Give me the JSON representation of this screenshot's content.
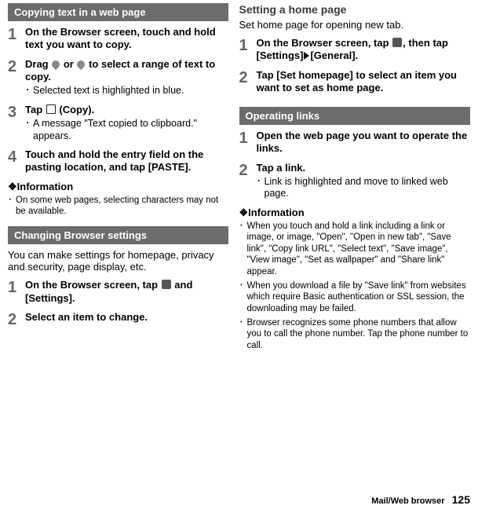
{
  "left": {
    "s1": {
      "header": "Copying text in a web page",
      "steps": [
        {
          "num": "1",
          "title": "On the Browser screen, touch and hold text you want to copy."
        },
        {
          "num": "2",
          "title_pre": "Drag ",
          "title_mid": " or ",
          "title_post": " to select a range of text to copy.",
          "bullets": [
            "Selected text is highlighted in blue."
          ]
        },
        {
          "num": "3",
          "title_pre": "Tap ",
          "title_post": " (Copy).",
          "bullets": [
            "A message \"Text copied to clipboard.\" appears."
          ]
        },
        {
          "num": "4",
          "title": "Touch and hold the entry field on the pasting location, and tap [PASTE]."
        }
      ],
      "info_head": "❖Information",
      "info": [
        "On some web pages, selecting characters may not be available."
      ]
    },
    "s2": {
      "header": "Changing Browser settings",
      "intro": "You can make settings for homepage, privacy and security, page display, etc.",
      "steps": [
        {
          "num": "1",
          "title_pre": "On the Browser screen, tap ",
          "title_post": " and [Settings]."
        },
        {
          "num": "2",
          "title": "Select an item to change."
        }
      ]
    }
  },
  "right": {
    "s3": {
      "header": "Setting a home page",
      "intro": "Set home page for opening new tab.",
      "steps": [
        {
          "num": "1",
          "title_pre": "On the Browser screen, tap ",
          "title_mid": ", then tap [Settings]",
          "title_post": "[General]."
        },
        {
          "num": "2",
          "title": "Tap [Set homepage] to select an item you want to set as home page."
        }
      ]
    },
    "s4": {
      "header": "Operating links",
      "steps": [
        {
          "num": "1",
          "title": "Open the web page you want to operate the links."
        },
        {
          "num": "2",
          "title": "Tap a link.",
          "bullets": [
            "Link is highlighted and move to linked web page."
          ]
        }
      ],
      "info_head": "❖Information",
      "info": [
        "When you touch and hold a link including a link or image, or image, \"Open\", \"Open in new tab\", \"Save link\", \"Copy link URL\", \"Select text\", \"Save image\", \"View image\", \"Set as wallpaper\" and \"Share link\" appear.",
        "When you download a file by \"Save link\" from websites which require Basic authentication or SSL session, the downloading may be failed.",
        "Browser recognizes some phone numbers that allow you to call the phone number. Tap the phone number to call."
      ]
    }
  },
  "footer": {
    "label": "Mail/Web browser",
    "page": "125"
  }
}
